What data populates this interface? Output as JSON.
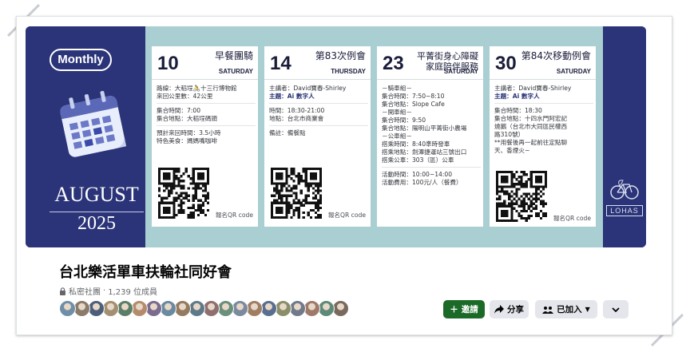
{
  "cover": {
    "badge": "Monthly",
    "month": "AUGUST",
    "year": "2025",
    "logo_text": "LOHAS",
    "cards": [
      {
        "day": "10",
        "title": "早餐團騎",
        "dow": "SATURDAY",
        "groups": [
          [
            "路線：大稻埕🚴十三行博物館",
            "來回公里數：42公里"
          ],
          [
            "集合時間：7:00",
            "集合地點：大稻埕碼頭"
          ],
          [
            "預計來回時間：3.5小時",
            "特色美食：媽媽嘴咖啡"
          ]
        ],
        "qr_label": "報名QR code"
      },
      {
        "day": "14",
        "title": "第83次例會",
        "dow": "THURSDAY",
        "groups": [
          [
            "主講者：David寶春-Shirley",
            "主題：Ai 數字人"
          ],
          [
            "時間：18:30-21:00",
            "地點：台北市商業會"
          ],
          [
            "備註：備餐點"
          ]
        ],
        "qr_label": "報名QR code"
      },
      {
        "day": "23",
        "title": "平菁街身心障礙家庭陪伴服務",
        "dow": "SATURDAY",
        "groups": [
          [
            "－騎車組－",
            "集合時間：7:50~8:10",
            "集合地點：Slope Cafe",
            "－開車組－",
            "集合時間：9:50",
            "集合地點：陽明山平菁街小農場",
            "－公車組－",
            "搭乘時間：8:40準時發車",
            "搭乘地點：劍潭捷運站三號出口",
            "搭乘公車：303（區）公車"
          ],
          [
            "活動時間：10:00~14:00",
            "活動費用：100元/人（餐費）"
          ]
        ],
        "qr_label": ""
      },
      {
        "day": "30",
        "title": "第84次移動例會",
        "dow": "SATURDAY",
        "groups": [
          [
            "主講者：David寶春-Shirley",
            "主題：Ai 數字人"
          ],
          [
            "集合時間：18:30",
            "集合地點：十四水門阿宏記",
            "燒鵝（台北市大同區民權西",
            "路310號）",
            "**用餐後再一起前往定點聊",
            "天、香煙火~"
          ]
        ],
        "qr_label": "報名QR code"
      }
    ]
  },
  "group": {
    "name": "台北樂活單車扶輪社同好會",
    "privacy": "私密社團",
    "members": "1,239 位成員"
  },
  "actions": {
    "invite": "邀請",
    "share": "分享",
    "joined": "已加入",
    "more": ""
  },
  "colors": {
    "navy": "#2b3478",
    "panel": "#a9cfd2",
    "invite_green": "#1b6a28",
    "button_gray": "#e4e6eb"
  }
}
